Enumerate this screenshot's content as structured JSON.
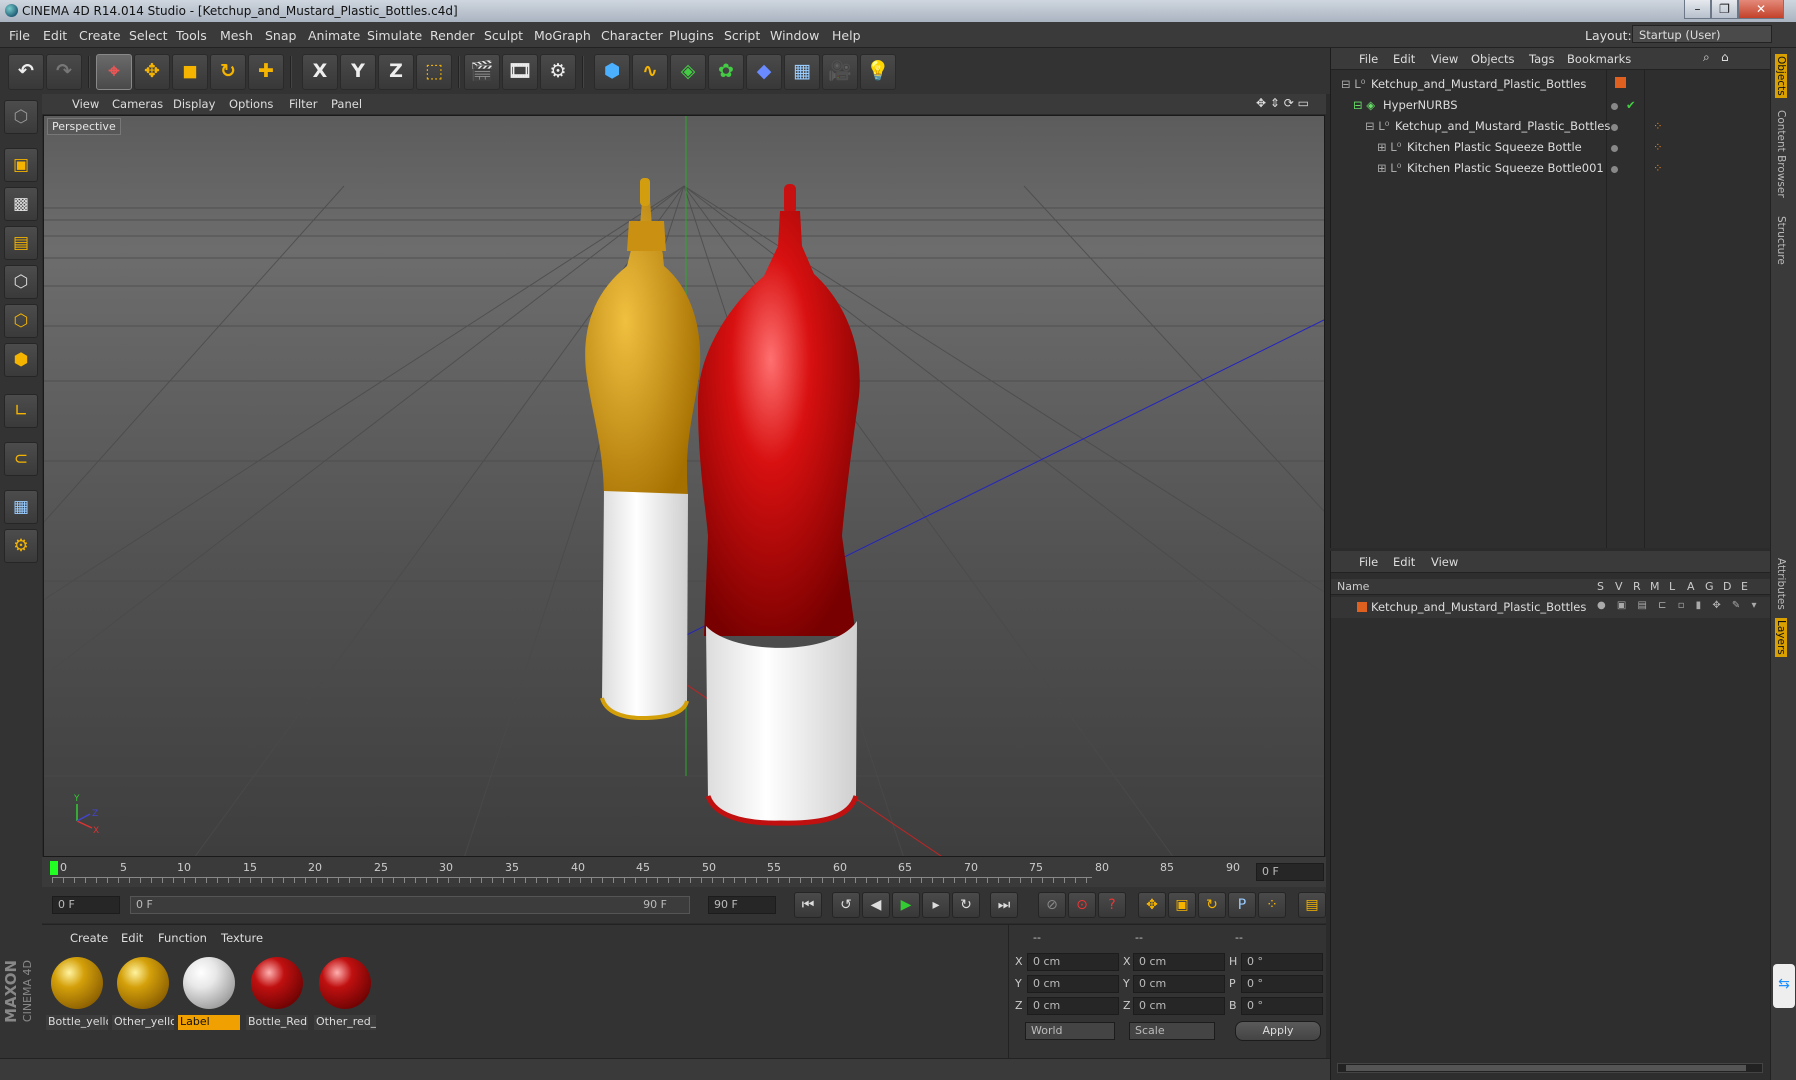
{
  "window": {
    "title": "CINEMA 4D R14.014 Studio - [Ketchup_and_Mustard_Plastic_Bottles.c4d]",
    "layout_label": "Layout:",
    "layout_value": "Startup (User)"
  },
  "menu": [
    "File",
    "Edit",
    "Create",
    "Select",
    "Tools",
    "Mesh",
    "Snap",
    "Animate",
    "Simulate",
    "Render",
    "Sculpt",
    "MoGraph",
    "Character",
    "Plugins",
    "Script",
    "Window",
    "Help"
  ],
  "toolbar": {
    "x_axis": "X",
    "y_axis": "Y",
    "z_axis": "Z"
  },
  "viewport": {
    "menu": [
      "View",
      "Cameras",
      "Display",
      "Options",
      "Filter",
      "Panel"
    ],
    "label": "Perspective"
  },
  "timeline": {
    "ticks": [
      "0",
      "5",
      "10",
      "15",
      "20",
      "25",
      "30",
      "35",
      "40",
      "45",
      "50",
      "55",
      "60",
      "65",
      "70",
      "75",
      "80",
      "85",
      "90"
    ],
    "frame_field": "0 F"
  },
  "transport": {
    "start_field": "0 F",
    "range_start": "0 F",
    "range_end": "90 F",
    "end_field": "90 F"
  },
  "materials": {
    "menu": [
      "Create",
      "Edit",
      "Function",
      "Texture"
    ],
    "items": [
      {
        "name": "Bottle_yello",
        "color": "#d4a00a"
      },
      {
        "name": "Other_yello",
        "color": "#d4a00a"
      },
      {
        "name": "Label",
        "color": "#e8e8e8"
      },
      {
        "name": "Bottle_Red",
        "color": "#c01010"
      },
      {
        "name": "Other_red_",
        "color": "#c01010"
      }
    ]
  },
  "coords": {
    "headers": [
      "--",
      "--",
      "--"
    ],
    "rows": [
      {
        "a": "X",
        "av": "0 cm",
        "b": "X",
        "bv": "0 cm",
        "c": "H",
        "cv": "0 °"
      },
      {
        "a": "Y",
        "av": "0 cm",
        "b": "Y",
        "bv": "0 cm",
        "c": "P",
        "cv": "0 °"
      },
      {
        "a": "Z",
        "av": "0 cm",
        "b": "Z",
        "bv": "0 cm",
        "c": "B",
        "cv": "0 °"
      }
    ],
    "world": "World",
    "scale": "Scale",
    "apply": "Apply"
  },
  "objects": {
    "menu": [
      "File",
      "Edit",
      "View",
      "Objects",
      "Tags",
      "Bookmarks"
    ],
    "tree": [
      "Ketchup_and_Mustard_Plastic_Bottles",
      "HyperNURBS",
      "Ketchup_and_Mustard_Plastic_Bottles",
      "Kitchen Plastic Squeeze Bottle",
      "Kitchen Plastic Squeeze Bottle001"
    ]
  },
  "layers": {
    "menu": [
      "File",
      "Edit",
      "View"
    ],
    "name_col": "Name",
    "cols": [
      "S",
      "V",
      "R",
      "M",
      "L",
      "A",
      "G",
      "D",
      "E"
    ],
    "row": "Ketchup_and_Mustard_Plastic_Bottles",
    "row_color": "#e06020"
  },
  "side_tabs": [
    "Objects",
    "Content Browser",
    "Structure",
    "Attributes",
    "Layers"
  ],
  "brand": [
    "MAXON",
    "CINEMA 4D"
  ]
}
